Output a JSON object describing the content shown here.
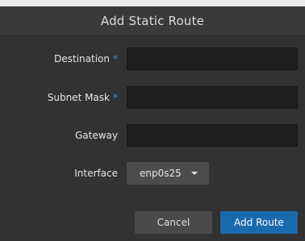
{
  "dialog": {
    "title": "Add Static Route",
    "required_marker": "*",
    "fields": {
      "destination": {
        "label": "Destination",
        "required": true,
        "value": ""
      },
      "subnet_mask": {
        "label": "Subnet Mask",
        "required": true,
        "value": ""
      },
      "gateway": {
        "label": "Gateway",
        "required": false,
        "value": ""
      },
      "interface": {
        "label": "Interface",
        "selected": "enp0s25"
      }
    },
    "buttons": {
      "cancel": "Cancel",
      "add": "Add Route"
    },
    "colors": {
      "accent": "#1a6aae",
      "required_marker": "#3b8fd1",
      "background": "#323232"
    },
    "icons": {
      "interface_dropdown": "caret-down-icon"
    }
  }
}
